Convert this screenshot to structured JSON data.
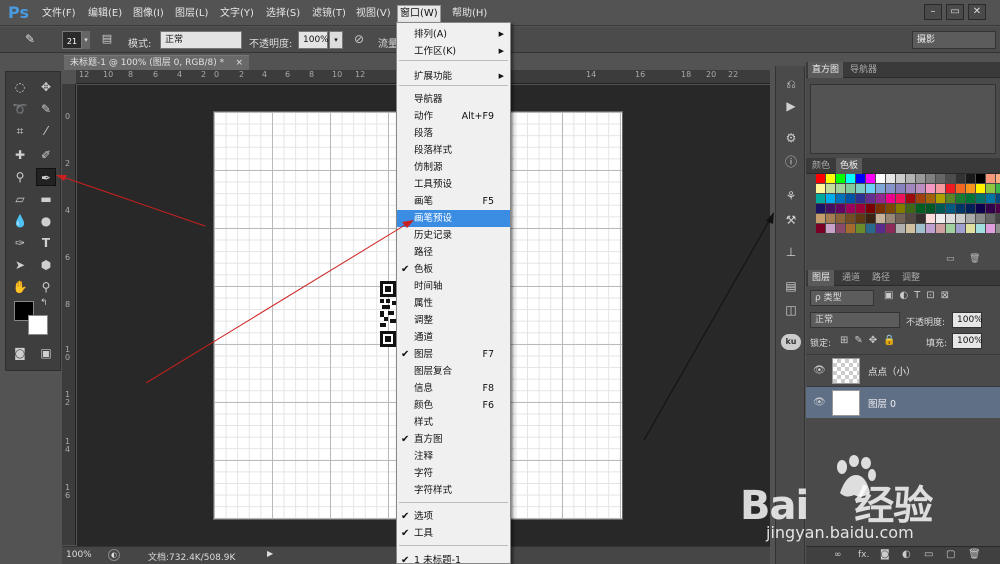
{
  "menubar": {
    "logo": "Ps",
    "items": [
      "文件(F)",
      "编辑(E)",
      "图像(I)",
      "图层(L)",
      "文字(Y)",
      "选择(S)",
      "滤镜(T)",
      "视图(V)",
      "窗口(W)",
      "帮助(H)"
    ],
    "window_controls": [
      "–",
      "▭",
      "✕"
    ]
  },
  "options": {
    "brush_size": "21",
    "mode_label": "模式:",
    "mode_value": "正常",
    "opacity_label": "不透明度:",
    "opacity_value": "100%",
    "flow_label": "流量",
    "workspace": "摄影"
  },
  "document": {
    "tab_title": "未标题-1 @ 100% (图层 0, RGB/8) *",
    "close": "×",
    "zoom": "100%",
    "doc_info": "文档:732.4K/508.9K",
    "ruler_top": [
      "12",
      "10",
      "8",
      "6",
      "4",
      "2",
      "0",
      "2",
      "4",
      "6",
      "8",
      "10",
      "12",
      "14",
      "16",
      "18",
      "20",
      "22"
    ],
    "ruler_left": [
      "0",
      "2",
      "4",
      "6",
      "8",
      "1 0",
      "1 2",
      "1 4",
      "1 6"
    ]
  },
  "window_menu": {
    "items": [
      {
        "label": "排列(A)",
        "submenu": true
      },
      {
        "label": "工作区(K)",
        "submenu": true
      },
      {
        "label": "扩展功能",
        "submenu": true
      },
      {
        "label": "导航器"
      },
      {
        "label": "动作",
        "shortcut": "Alt+F9"
      },
      {
        "label": "段落"
      },
      {
        "label": "段落样式"
      },
      {
        "label": "仿制源"
      },
      {
        "label": "工具预设"
      },
      {
        "label": "画笔",
        "shortcut": "F5"
      },
      {
        "label": "画笔预设",
        "highlighted": true
      },
      {
        "label": "历史记录"
      },
      {
        "label": "路径"
      },
      {
        "label": "色板",
        "checked": true
      },
      {
        "label": "时间轴"
      },
      {
        "label": "属性"
      },
      {
        "label": "调整"
      },
      {
        "label": "通道"
      },
      {
        "label": "图层",
        "checked": true,
        "shortcut": "F7"
      },
      {
        "label": "图层复合"
      },
      {
        "label": "信息",
        "shortcut": "F8"
      },
      {
        "label": "颜色",
        "shortcut": "F6"
      },
      {
        "label": "样式"
      },
      {
        "label": "直方图",
        "checked": true
      },
      {
        "label": "注释"
      },
      {
        "label": "字符"
      },
      {
        "label": "字符样式"
      },
      {
        "label": "选项",
        "checked": true
      },
      {
        "label": "工具",
        "checked": true
      },
      {
        "label": "1 未标题-1",
        "checked": true
      }
    ]
  },
  "panels": {
    "histogram_tabs": [
      "直方图",
      "导航器"
    ],
    "swatch_tabs": [
      "颜色",
      "色板"
    ],
    "layer_tabs": [
      "图层",
      "通道",
      "路径",
      "调整"
    ],
    "filter_kind": "ρ 类型",
    "blend_mode": "正常",
    "opacity_label": "不透明度:",
    "opacity_value": "100%",
    "lock_label": "锁定:",
    "fill_label": "填充:",
    "fill_value": "100%",
    "layers": [
      {
        "name": "点点（小）",
        "selected": false
      },
      {
        "name": "图层 0",
        "selected": true
      }
    ],
    "bottom_icons": [
      "∞",
      "fx."
    ]
  },
  "colors": {
    "menu_highlight": "#3b8de4",
    "annotation_arrow": "#cc1f1f",
    "layer_selected": "#5f6f86"
  },
  "watermark": {
    "brand": "Bai",
    "brand_cn": "经验",
    "url": "jingyan.baidu.com"
  }
}
